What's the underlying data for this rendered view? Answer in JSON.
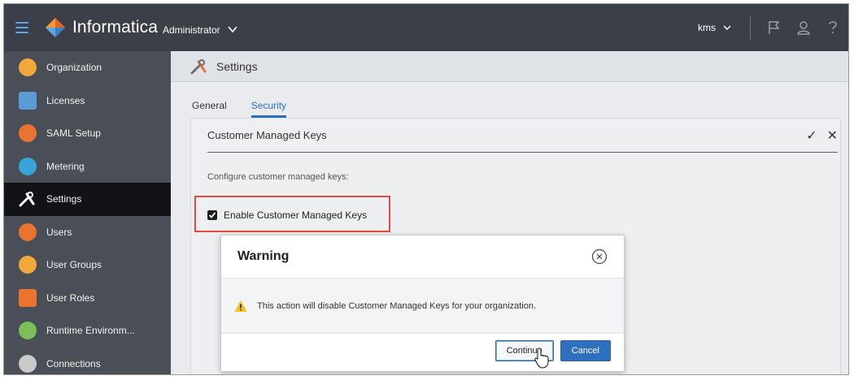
{
  "header": {
    "brand": "Informatica",
    "app": "Administrator",
    "user": "kms"
  },
  "sidebar": {
    "items": [
      {
        "label": "Organization",
        "icon": "organization-icon",
        "color": "#f2a93b"
      },
      {
        "label": "Licenses",
        "icon": "licenses-icon",
        "color": "#5b9bd5"
      },
      {
        "label": "SAML Setup",
        "icon": "saml-icon",
        "color": "#e8742f"
      },
      {
        "label": "Metering",
        "icon": "metering-icon",
        "color": "#3aa3d8"
      },
      {
        "label": "Settings",
        "icon": "settings-icon",
        "color": "#ffffff",
        "active": true
      },
      {
        "label": "Users",
        "icon": "users-icon",
        "color": "#e8742f"
      },
      {
        "label": "User Groups",
        "icon": "user-groups-icon",
        "color": "#f2a93b"
      },
      {
        "label": "User Roles",
        "icon": "user-roles-icon",
        "color": "#e8742f"
      },
      {
        "label": "Runtime Environm...",
        "icon": "runtime-icon",
        "color": "#7bbf5a"
      },
      {
        "label": "Connections",
        "icon": "connections-icon",
        "color": "#c9c9c9"
      }
    ]
  },
  "main": {
    "page_title": "Settings",
    "tabs": [
      {
        "label": "General",
        "active": false
      },
      {
        "label": "Security",
        "active": true
      }
    ],
    "panel": {
      "title": "Customer Managed Keys",
      "save_glyph": "✓",
      "close_glyph": "✕",
      "description": "Configure customer managed keys:",
      "checkbox_label": "Enable Customer Managed Keys",
      "checkbox_checked": true
    }
  },
  "dialog": {
    "title": "Warning",
    "message": "This action will disable Customer Managed Keys for your organization.",
    "continue_label": "Continue",
    "cancel_label": "Cancel"
  },
  "colors": {
    "topbar": "#3b3f47",
    "sidebar": "#4a4e56",
    "accent": "#2a6fb8",
    "highlight": "#e64a3c"
  }
}
